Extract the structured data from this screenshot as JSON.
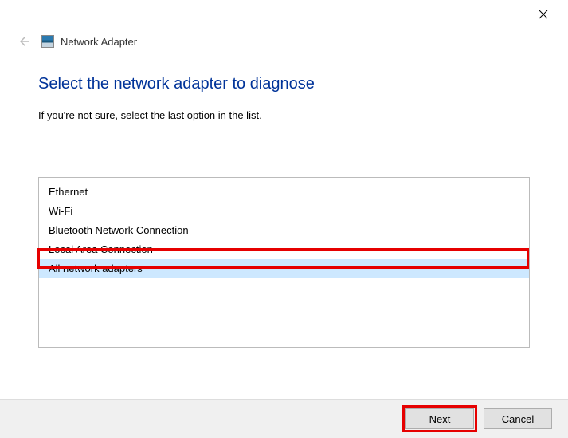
{
  "window": {
    "title": "Network Adapter"
  },
  "main": {
    "heading": "Select the network adapter to diagnose",
    "subtext": "If you're not sure, select the last option in the list."
  },
  "adapters": {
    "items": [
      {
        "label": "Ethernet",
        "selected": false
      },
      {
        "label": "Wi-Fi",
        "selected": false
      },
      {
        "label": "Bluetooth Network Connection",
        "selected": false
      },
      {
        "label": "Local Area Connection",
        "selected": false
      },
      {
        "label": "All network adapters",
        "selected": true
      }
    ]
  },
  "footer": {
    "next_label": "Next",
    "cancel_label": "Cancel"
  },
  "annotations": {
    "highlight_item": "All network adapters",
    "highlight_button": "Next"
  }
}
